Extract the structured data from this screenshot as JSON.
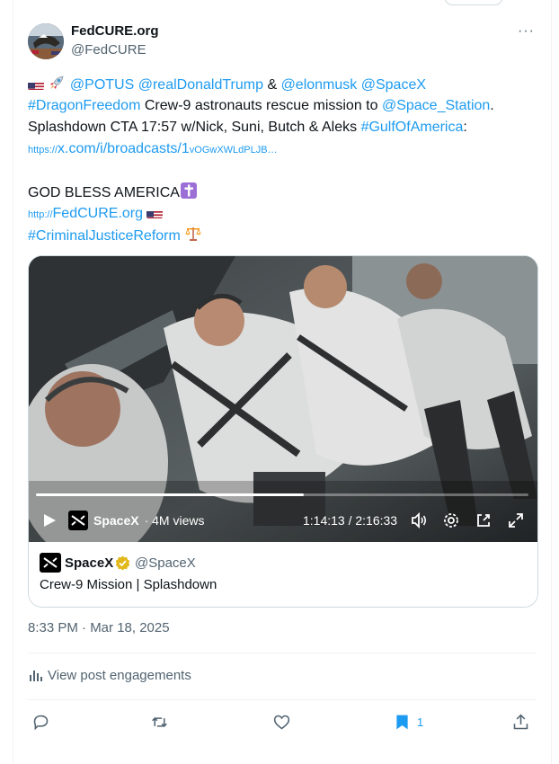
{
  "author": {
    "name": "FedCURE.org",
    "handle": "@FedCURE"
  },
  "more_label": "···",
  "tweet": {
    "line1": {
      "mention_potus": "@POTUS",
      "mention_trump": "@realDonaldTrump",
      "amp": "&",
      "mention_elon": "@elonmusk",
      "mention_spacex": "@SpaceX"
    },
    "line2": {
      "hashtag": "#DragonFreedom",
      "text": "Crew-9 astronauts rescue mission to",
      "mention_station": "@Space_Station",
      "period": "."
    },
    "line3": {
      "text": "Splashdown CTA 17:57 w/Nick, Suni, Butch & Aleks",
      "hashtag": "#GulfOfAmerica",
      "colon": ":"
    },
    "link_broadcast": {
      "proto": "https://",
      "main": "x.com/i/broadcasts/1",
      "tail": "vOGwXWLdPLJB…"
    },
    "god_bless": "GOD BLESS AMERICA",
    "link_site": {
      "proto": "http://",
      "main": "FedCURE.org"
    },
    "hashtag_reform": "#CriminalJusticeReform"
  },
  "video": {
    "channel": "SpaceX",
    "views": "· 4M views",
    "time": "1:14:13 / 2:16:33",
    "progress": 0.543
  },
  "card": {
    "name": "SpaceX",
    "handle": "@SpaceX",
    "title": "Crew-9 Mission | Splashdown"
  },
  "timestamp": "8:33 PM · Mar 18, 2025",
  "engagements_label": "View post engagements",
  "bookmark_count": "1",
  "colors": {
    "link": "#1d9bf0",
    "muted": "#536471",
    "divider": "#eff3f4",
    "verified": "#e2b719"
  },
  "icons": [
    "us-flag-icon",
    "rocket-icon",
    "latin-cross-icon",
    "scales-icon",
    "play-icon",
    "volume-icon",
    "settings-icon",
    "popout-icon",
    "fullscreen-icon",
    "verified-icon",
    "analytics-icon",
    "reply-icon",
    "repost-icon",
    "like-icon",
    "bookmark-icon",
    "share-icon"
  ]
}
